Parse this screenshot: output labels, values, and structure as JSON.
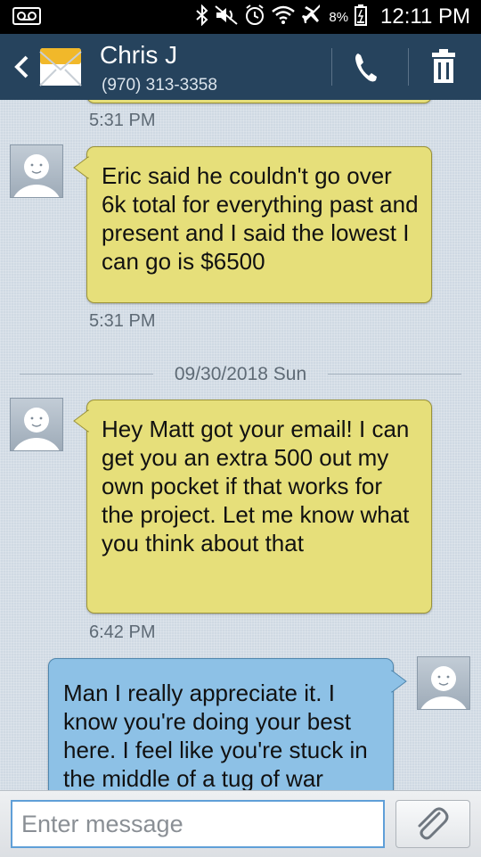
{
  "status_bar": {
    "battery": "8%",
    "time": "12:11 PM",
    "icons": [
      "voicemail-icon",
      "bluetooth-icon",
      "mute-icon",
      "alarm-icon",
      "wifi-icon",
      "airplane-icon",
      "battery-icon"
    ]
  },
  "header": {
    "contact_name": "Chris J",
    "contact_number": "(970) 313-3358",
    "icons": [
      "back-icon",
      "message-envelope-icon",
      "call-icon",
      "delete-icon"
    ],
    "colors": {
      "background": "#26435d"
    }
  },
  "conversation": {
    "messages": [
      {
        "direction": "incoming",
        "text": "",
        "time": "5:31 PM"
      },
      {
        "direction": "incoming",
        "text": "Eric said he couldn't go over 6k total for everything past and present and I said the lowest I can go is $6500",
        "time": "5:31 PM"
      },
      {
        "date_separator": "09/30/2018 Sun"
      },
      {
        "direction": "incoming",
        "text": "Hey Matt got your email! I can get you an extra 500 out my own pocket if that works for the project. Let me know what you think about that",
        "time": "6:42 PM"
      },
      {
        "direction": "outgoing",
        "text": "Man I really appreciate it.  I know you're doing your best here.  I feel like you're stuck in the middle of a tug of war"
      }
    ],
    "colors": {
      "incoming_bubble": "#e6df7a",
      "outgoing_bubble": "#8dc1e6"
    }
  },
  "input_bar": {
    "placeholder": "Enter message",
    "value": "",
    "icons": [
      "attach-paperclip-icon"
    ]
  }
}
